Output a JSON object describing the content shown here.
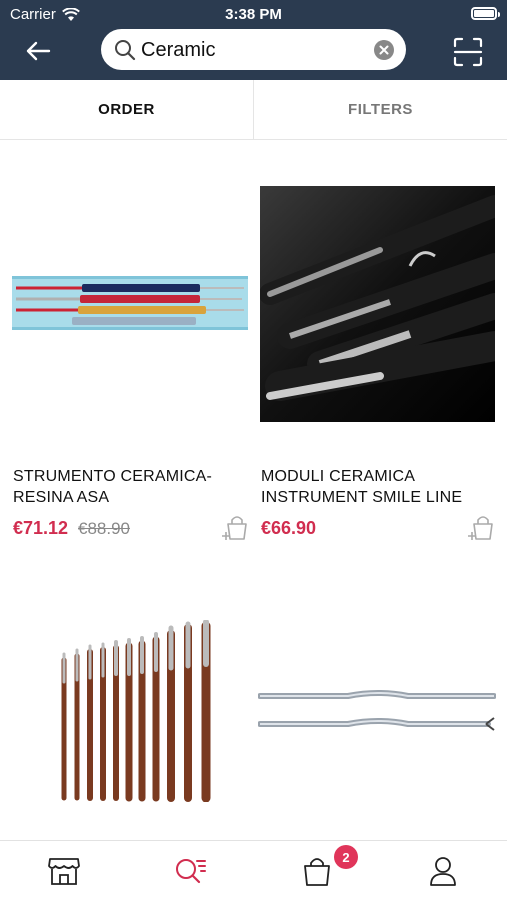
{
  "status_bar": {
    "carrier": "Carrier",
    "time": "3:38 PM"
  },
  "search": {
    "value": "Ceramic",
    "placeholder": ""
  },
  "tabs": {
    "order": "ORDER",
    "filters": "FILTERS"
  },
  "products": [
    {
      "title": "STRUMENTO CERAMICA-RESINA ASA",
      "price": "€71.12",
      "old_price": "€88.90"
    },
    {
      "title": "MODULI CERAMICA INSTRUMENT SMILE LINE",
      "price": "€66.90",
      "old_price": ""
    },
    {
      "title": "",
      "price": "",
      "old_price": ""
    },
    {
      "title": "",
      "price": "",
      "old_price": ""
    }
  ],
  "cart": {
    "badge": "2"
  },
  "colors": {
    "header": "#2b3b50",
    "accent": "#d12d4f",
    "badge": "#e0355a"
  },
  "icons": [
    "wifi-icon",
    "battery-icon",
    "back-arrow-icon",
    "search-icon",
    "clear-icon",
    "scan-icon",
    "add-to-cart-icon",
    "store-icon",
    "search-list-icon",
    "bag-icon",
    "user-icon"
  ]
}
